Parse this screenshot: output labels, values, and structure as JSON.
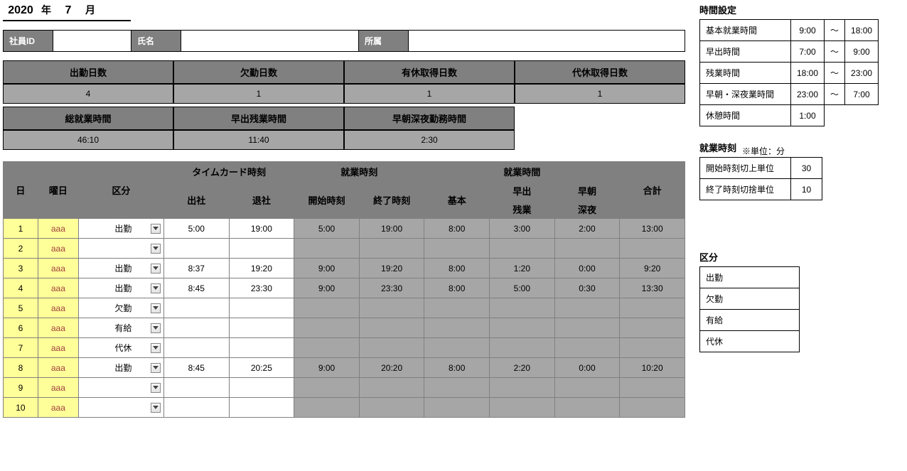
{
  "date": {
    "year": "2020",
    "year_unit": "年",
    "month": "7",
    "month_unit": "月"
  },
  "emp": {
    "id_label": "社員ID",
    "id_val": "",
    "name_label": "氏名",
    "name_val": "",
    "dept_label": "所属",
    "dept_val": ""
  },
  "summary1": {
    "h1": "出勤日数",
    "v1": "4",
    "h2": "欠勤日数",
    "v2": "1",
    "h3": "有休取得日数",
    "v3": "1",
    "h4": "代休取得日数",
    "v4": "1"
  },
  "summary2": {
    "h1": "総就業時間",
    "v1": "46:10",
    "h2": "早出残業時間",
    "v2": "11:40",
    "h3": "早朝深夜勤務時間",
    "v3": "2:30"
  },
  "main_hdr": {
    "day": "日",
    "dow": "曜日",
    "type": "区分",
    "tc": "タイムカード時刻",
    "tc_in": "出社",
    "tc_out": "退社",
    "wk": "就業時刻",
    "wk_start": "開始時刻",
    "wk_end": "終了時刻",
    "wt": "就業時間",
    "wt_basic": "基本",
    "wt_ot1": "早出",
    "wt_ot2": "残業",
    "wt_mn1": "早朝",
    "wt_mn2": "深夜",
    "total": "合計"
  },
  "rows": [
    {
      "day": "1",
      "dow": "aaa",
      "type": "出勤",
      "in": "5:00",
      "out": "19:00",
      "start": "5:00",
      "end": "19:00",
      "basic": "8:00",
      "ot": "3:00",
      "mn": "2:00",
      "total": "13:00"
    },
    {
      "day": "2",
      "dow": "aaa",
      "type": "",
      "in": "",
      "out": "",
      "start": "",
      "end": "",
      "basic": "",
      "ot": "",
      "mn": "",
      "total": ""
    },
    {
      "day": "3",
      "dow": "aaa",
      "type": "出勤",
      "in": "8:37",
      "out": "19:20",
      "start": "9:00",
      "end": "19:20",
      "basic": "8:00",
      "ot": "1:20",
      "mn": "0:00",
      "total": "9:20"
    },
    {
      "day": "4",
      "dow": "aaa",
      "type": "出勤",
      "in": "8:45",
      "out": "23:30",
      "start": "9:00",
      "end": "23:30",
      "basic": "8:00",
      "ot": "5:00",
      "mn": "0:30",
      "total": "13:30"
    },
    {
      "day": "5",
      "dow": "aaa",
      "type": "欠勤",
      "in": "",
      "out": "",
      "start": "",
      "end": "",
      "basic": "",
      "ot": "",
      "mn": "",
      "total": ""
    },
    {
      "day": "6",
      "dow": "aaa",
      "type": "有給",
      "in": "",
      "out": "",
      "start": "",
      "end": "",
      "basic": "",
      "ot": "",
      "mn": "",
      "total": ""
    },
    {
      "day": "7",
      "dow": "aaa",
      "type": "代休",
      "in": "",
      "out": "",
      "start": "",
      "end": "",
      "basic": "",
      "ot": "",
      "mn": "",
      "total": ""
    },
    {
      "day": "8",
      "dow": "aaa",
      "type": "出勤",
      "in": "8:45",
      "out": "20:25",
      "start": "9:00",
      "end": "20:20",
      "basic": "8:00",
      "ot": "2:20",
      "mn": "0:00",
      "total": "10:20"
    },
    {
      "day": "9",
      "dow": "aaa",
      "type": "",
      "in": "",
      "out": "",
      "start": "",
      "end": "",
      "basic": "",
      "ot": "",
      "mn": "",
      "total": ""
    },
    {
      "day": "10",
      "dow": "aaa",
      "type": "",
      "in": "",
      "out": "",
      "start": "",
      "end": "",
      "basic": "",
      "ot": "",
      "mn": "",
      "total": ""
    }
  ],
  "time_settings": {
    "title": "時間設定",
    "rows": [
      {
        "lbl": "基本就業時間",
        "a": "9:00",
        "s": "～",
        "b": "18:00"
      },
      {
        "lbl": "早出時間",
        "a": "7:00",
        "s": "～",
        "b": "9:00"
      },
      {
        "lbl": "残業時間",
        "a": "18:00",
        "s": "～",
        "b": "23:00"
      },
      {
        "lbl": "早朝・深夜業時間",
        "a": "23:00",
        "s": "～",
        "b": "7:00"
      },
      {
        "lbl": "休憩時間",
        "a": "1:00",
        "s": "",
        "b": ""
      }
    ]
  },
  "work_settings": {
    "title": "就業時刻",
    "note": "※単位：分",
    "rows": [
      {
        "lbl": "開始時刻切上単位",
        "v": "30"
      },
      {
        "lbl": "終了時刻切捨単位",
        "v": "10"
      }
    ]
  },
  "kubun": {
    "title": "区分",
    "items": [
      "出勤",
      "欠勤",
      "有給",
      "代休"
    ]
  }
}
